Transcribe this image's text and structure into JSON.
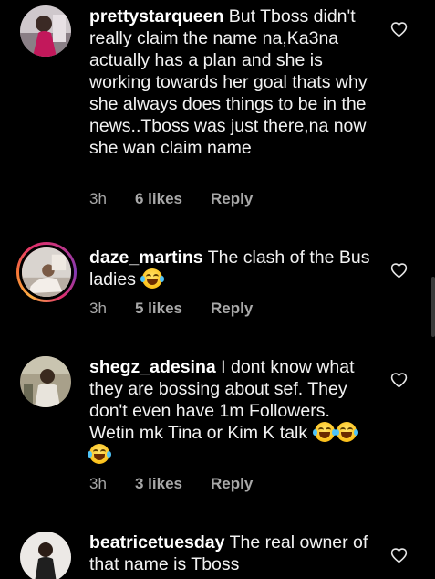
{
  "comments": [
    {
      "username": "prettystarqueen",
      "text": "But Tboss didn't really claim the name na,Ka3na actually has a plan and she is working towards her goal thats why she always does things to be in the news..Tboss was just there,na now she wan claim name",
      "time": "3h",
      "likes": "6 likes",
      "reply": "Reply",
      "avatar_icon": "profile-photo"
    },
    {
      "username": "daze_martins",
      "text": "The clash of the Bus ladies",
      "emoji_count": 1,
      "time": "3h",
      "likes": "5 likes",
      "reply": "Reply",
      "avatar_icon": "profile-photo-story-ring"
    },
    {
      "username": "shegz_adesina",
      "text": "I dont know what they are bossing about sef. They don't even have 1m Followers. Wetin mk Tina or Kim K talk",
      "emoji_count": 3,
      "time": "3h",
      "likes": "3 likes",
      "reply": "Reply",
      "avatar_icon": "profile-photo"
    },
    {
      "username": "beatricetuesday",
      "text": "The real owner of that name is Tboss",
      "avatar_icon": "profile-photo"
    }
  ],
  "icons": {
    "like": "heart-outline-icon",
    "emoji": "face-with-tears-of-joy"
  },
  "colors": {
    "background": "#000000",
    "text": "#f2f2f2",
    "meta": "#a8a8a8"
  }
}
